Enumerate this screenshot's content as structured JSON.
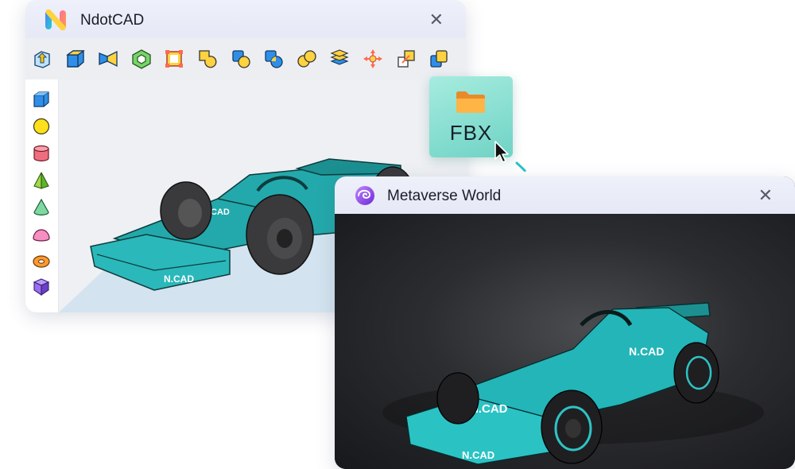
{
  "cad_window": {
    "title": "NdotCAD",
    "close_icon": "close-icon",
    "toolbar": [
      "extrude-icon",
      "box-icon",
      "revolve-icon",
      "shell-icon",
      "bounding-frame-icon",
      "union-icon",
      "subtract-icon",
      "intersect-icon",
      "merge-circles-icon",
      "layers-icon",
      "move-icon",
      "scale-icon",
      "copy-icon"
    ],
    "sidebar_shapes": [
      "cube-icon",
      "sphere-icon",
      "cylinder-icon",
      "pyramid-icon",
      "cone-icon",
      "hemisphere-icon",
      "torus-icon",
      "prism-icon"
    ],
    "model_text": "N.CAD"
  },
  "metaverse_window": {
    "title": "Metaverse World",
    "close_icon": "close-icon",
    "model_text": "N.CAD"
  },
  "fbx_badge": {
    "label": "FBX",
    "icon": "folder-icon"
  },
  "colors": {
    "accent": "#2ec3c5",
    "car_teal": "#23a9ab",
    "fbx_bg": "#84dccf"
  }
}
